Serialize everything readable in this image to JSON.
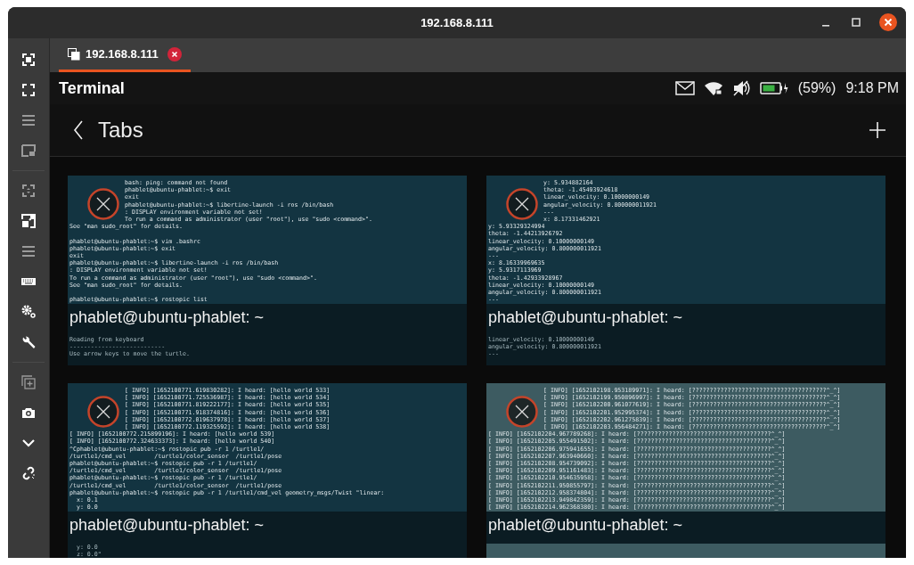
{
  "window": {
    "title": "192.168.8.111"
  },
  "sidebar": {
    "tools": [
      {
        "disabled": false
      },
      {
        "disabled": false
      },
      {
        "disabled": true
      },
      {
        "disabled": true
      },
      {
        "disabled": true
      },
      {
        "disabled": false
      },
      {
        "disabled": true
      },
      {
        "disabled": false
      },
      {
        "disabled": false
      },
      {
        "disabled": false
      },
      {
        "disabled": true
      },
      {
        "disabled": false
      },
      {
        "disabled": false
      },
      {
        "disabled": false
      }
    ]
  },
  "tabs": [
    {
      "label": "192.168.8.111",
      "selected": true
    }
  ],
  "app": {
    "title": "Terminal",
    "battery_text": "(59%)",
    "time": "9:18 PM",
    "page_title": "Tabs"
  },
  "terminal_tabs": [
    {
      "color": "#133441",
      "label": "phablet@ubuntu-phablet: ~",
      "blocks": [
        [
          "bash: ping: command not found",
          "phablet@ubuntu-phablet:~$ exit",
          "exit",
          "phablet@ubuntu-phablet:~$ libertine-launch -i ros /bin/bash",
          ": DISPLAY environment variable not set!",
          "To run a command as administrator (user \"root\"), use \"sudo <command>\".",
          "See \"man sudo_root\" for details."
        ],
        [
          "phablet@ubuntu-phablet:~$ vim .bashrc",
          "phablet@ubuntu-phablet:~$ exit",
          "exit",
          "phablet@ubuntu-phablet:~$ libertine-launch -i ros /bin/bash",
          ": DISPLAY environment variable not set!",
          "To run a command as administrator (user \"root\"), use \"sudo <command>\".",
          "See \"man sudo_root\" for details."
        ],
        [
          "phablet@ubuntu-phablet:~$ rostopic list"
        ]
      ],
      "below": [
        "Reading from keyboard",
        "---------------------------",
        "Use arrow keys to move the turtle."
      ]
    },
    {
      "color": "#133441",
      "label": "phablet@ubuntu-phablet: ~",
      "blocks": [
        [
          "y: 5.934882164",
          "theta: -1.45493924618",
          "linear_velocity: 0.10000000149",
          "angular_velocity: 0.800000011921",
          "---",
          "x: 8.17331462921",
          "y: 5.93329324994",
          "theta: -1.44213926792",
          "linear_velocity: 0.10000000149",
          "angular_velocity: 0.800000011921",
          "---",
          "x: 8.16339969635",
          "y: 5.9317113969",
          "theta: -1.42933928967",
          "linear_velocity: 0.10000000149",
          "angular_velocity: 0.800000011921",
          "---"
        ]
      ],
      "below": [
        "linear_velocity: 0.10000000149",
        "angular_velocity: 0.800000011921",
        "---"
      ]
    },
    {
      "color": "#133441",
      "label": "phablet@ubuntu-phablet: ~",
      "blocks": [
        [
          "[ INFO] [1652100771.619830282]: I heard: [hello world 533]",
          "[ INFO] [1652100771.725536987]: I heard: [hello world 534]",
          "[ INFO] [1652100771.819222177]: I heard: [hello world 535]",
          "[ INFO] [1652100771.918374816]: I heard: [hello world 536]",
          "[ INFO] [1652100772.019637978]: I heard: [hello world 537]",
          "[ INFO] [1652100772.119325592]: I heard: [hello world 538]",
          "[ INFO] [1652100772.215899196]: I heard: [hello world 539]",
          "[ INFO] [1652100772.324633373]: I heard: [hello world 540]",
          "^Cphablet@ubuntu-phablet:~$ rostopic pub -r 1 /turtle1/",
          "/turtle1/cmd_vel        /turtle1/color_sensor  /turtle1/pose",
          "phablet@ubuntu-phablet:~$ rostopic pub -r 1 /turtle1/",
          "/turtle1/cmd_vel        /turtle1/color_sensor  /turtle1/pose",
          "phablet@ubuntu-phablet:~$ rostopic pub -r 1 /turtle1/",
          "/turtle1/cmd_vel        /turtle1/color_sensor  /turtle1/pose",
          "phablet@ubuntu-phablet:~$ rostopic pub -r 1 /turtle1/cmd_vel geometry_msgs/Twist \"linear:",
          "  x: 0.1",
          "  y: 0.0"
        ]
      ],
      "below": [
        "  y: 0.0",
        "  z: 0.0\""
      ]
    },
    {
      "color": "#3d5b61",
      "label": "phablet@ubuntu-phablet: ~",
      "blocks": [
        [
          "[ INFO] [1652102198.953189971]: I heard: [??????????????????????????????????????^_^]",
          "[ INFO] [1652102199.950896997]: I heard: [??????????????????????????????????????^_^]",
          "[ INFO] [1652102200.961077619]: I heard: [??????????????????????????????????????^_^]",
          "[ INFO] [1652102201.952995374]: I heard: [??????????????????????????????????????^_^]",
          "[ INFO] [1652102202.961275839]: I heard: [??????????????????????????????????????^_^]",
          "[ INFO] [1652102203.956484271]: I heard: [??????????????????????????????????????^_^]",
          "[ INFO] [1652102204.967789268]: I heard: [??????????????????????????????????????^_^]",
          "[ INFO] [1652102205.955491502]: I heard: [??????????????????????????????????????^_^]",
          "[ INFO] [1652102206.975941655]: I heard: [??????????????????????????????????????^_^]",
          "[ INFO] [1652102207.963940660]: I heard: [??????????????????????????????????????^_^]",
          "[ INFO] [1652102208.954739092]: I heard: [??????????????????????????????????????^_^]",
          "[ INFO] [1652102209.951161483]: I heard: [??????????????????????????????????????^_^]",
          "[ INFO] [1652102210.954635958]: I heard: [??????????????????????????????????????^_^]",
          "[ INFO] [1652102211.950855797]: I heard: [??????????????????????????????????????^_^]",
          "[ INFO] [1652102212.958374804]: I heard: [??????????????????????????????????????^_^]",
          "[ INFO] [1652102213.949842359]: I heard: [??????????????????????????????????????^_^]",
          "[ INFO] [1652102214.962368380]: I heard: [??????????????????????????????????????^_^]"
        ]
      ]
    }
  ]
}
